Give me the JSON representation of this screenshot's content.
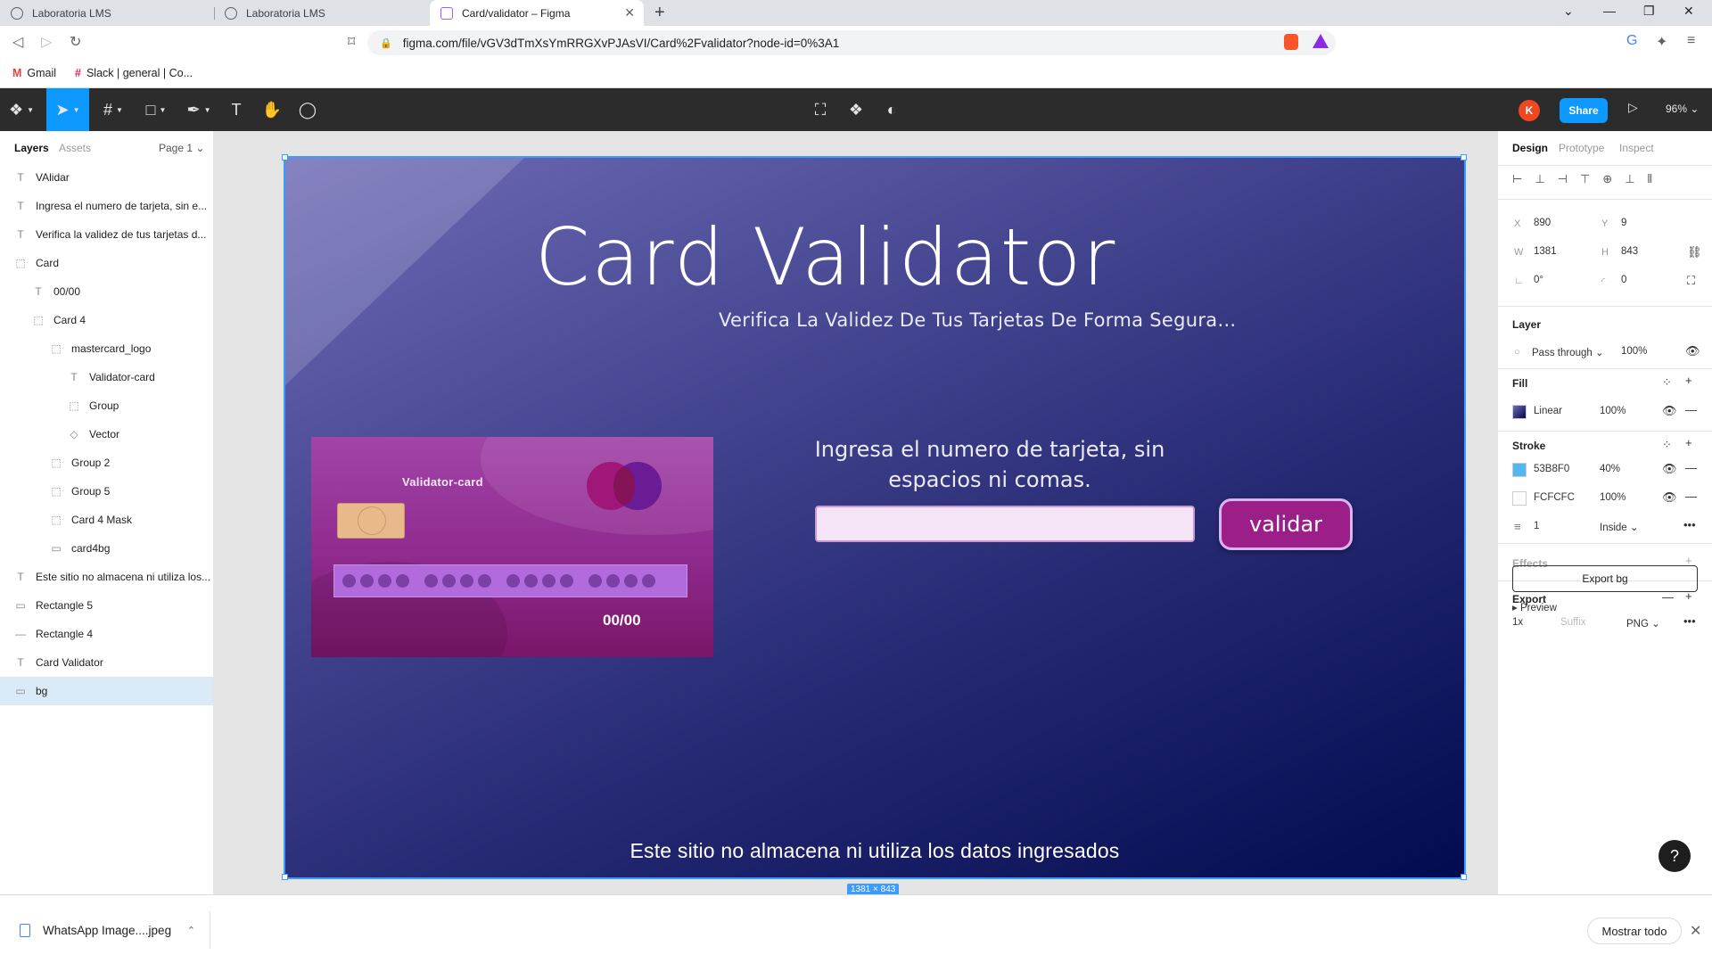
{
  "browser": {
    "tabs": [
      {
        "title": "Laboratoria LMS"
      },
      {
        "title": "Laboratoria LMS"
      },
      {
        "title": "Card/validator – Figma"
      }
    ],
    "url": "figma.com/file/vGV3dTmXsYmRRGXvPJAsVI/Card%2Fvalidator?node-id=0%3A1",
    "bookmarks": [
      {
        "label": "Gmail"
      },
      {
        "label": "Slack | general | Co..."
      }
    ],
    "brave_badge": "9"
  },
  "figma": {
    "toolbar": {
      "avatar_initial": "K",
      "share_label": "Share",
      "zoom": "96%"
    },
    "left_panel": {
      "tabs": {
        "layers": "Layers",
        "assets": "Assets"
      },
      "page": "Page 1",
      "layers": [
        {
          "name": "VAlidar",
          "icon": "T",
          "indent": 0
        },
        {
          "name": "Ingresa el numero de tarjeta, sin e...",
          "icon": "T",
          "indent": 0
        },
        {
          "name": "Verifica la validez de tus tarjetas d...",
          "icon": "T",
          "indent": 0
        },
        {
          "name": "Card",
          "icon": "⬚",
          "indent": 0
        },
        {
          "name": "00/00",
          "icon": "T",
          "indent": 1
        },
        {
          "name": "Card 4",
          "icon": "⬚",
          "indent": 1
        },
        {
          "name": "mastercard_logo",
          "icon": "⬚",
          "indent": 2
        },
        {
          "name": "Validator-card",
          "icon": "T",
          "indent": 3
        },
        {
          "name": "Group",
          "icon": "⬚",
          "indent": 3
        },
        {
          "name": "Vector",
          "icon": "◇",
          "indent": 3
        },
        {
          "name": "Group 2",
          "icon": "⬚",
          "indent": 2
        },
        {
          "name": "Group 5",
          "icon": "⬚",
          "indent": 2
        },
        {
          "name": "Card 4 Mask",
          "icon": "⬚",
          "indent": 2
        },
        {
          "name": "card4bg",
          "icon": "▭",
          "indent": 2
        },
        {
          "name": "Este sitio no almacena ni utiliza los...",
          "icon": "T",
          "indent": 0
        },
        {
          "name": "Rectangle 5",
          "icon": "▭",
          "indent": 0
        },
        {
          "name": "Rectangle 4",
          "icon": "—",
          "indent": 0
        },
        {
          "name": "Card Validator",
          "icon": "T",
          "indent": 0
        },
        {
          "name": "bg",
          "icon": "▭",
          "indent": 0,
          "selected": true
        }
      ]
    },
    "canvas": {
      "dimension_badge": "1381 × 843",
      "frame_title": "Card Validator",
      "subtitle": "Verifica La Validez De Tus Tarjetas De Forma Segura...",
      "instructions": "Ingresa el numero de tarjeta, sin espacios ni comas.",
      "button_label": "validar",
      "disclaimer": "Este sitio no almacena ni utiliza los datos ingresados",
      "card": {
        "name": "Validator-card",
        "expiry": "00/00"
      }
    },
    "right_panel": {
      "tabs": {
        "design": "Design",
        "prototype": "Prototype",
        "inspect": "Inspect"
      },
      "x_label": "X",
      "x": "890",
      "y_label": "Y",
      "y": "9",
      "w_label": "W",
      "w": "1381",
      "h_label": "H",
      "h": "843",
      "rotation": "0°",
      "radius": "0",
      "layer_heading": "Layer",
      "blend_mode": "Pass through",
      "layer_opacity": "100%",
      "fill_heading": "Fill",
      "fill_type": "Linear",
      "fill_opacity": "100%",
      "stroke_heading": "Stroke",
      "strokes": [
        {
          "hex": "53B8F0",
          "opacity": "40%",
          "color": "#53B8F0"
        },
        {
          "hex": "FCFCFC",
          "opacity": "100%",
          "color": "#FCFCFC"
        }
      ],
      "stroke_weight": "1",
      "stroke_position": "Inside",
      "effects_heading": "Effects",
      "export_heading": "Export",
      "export_scale": "1x",
      "export_suffix_placeholder": "Suffix",
      "export_format": "PNG",
      "export_button": "Export bg",
      "preview_label": "Preview",
      "help": "?"
    }
  },
  "downloads": {
    "file_name": "WhatsApp Image....jpeg",
    "show_all": "Mostrar todo"
  }
}
